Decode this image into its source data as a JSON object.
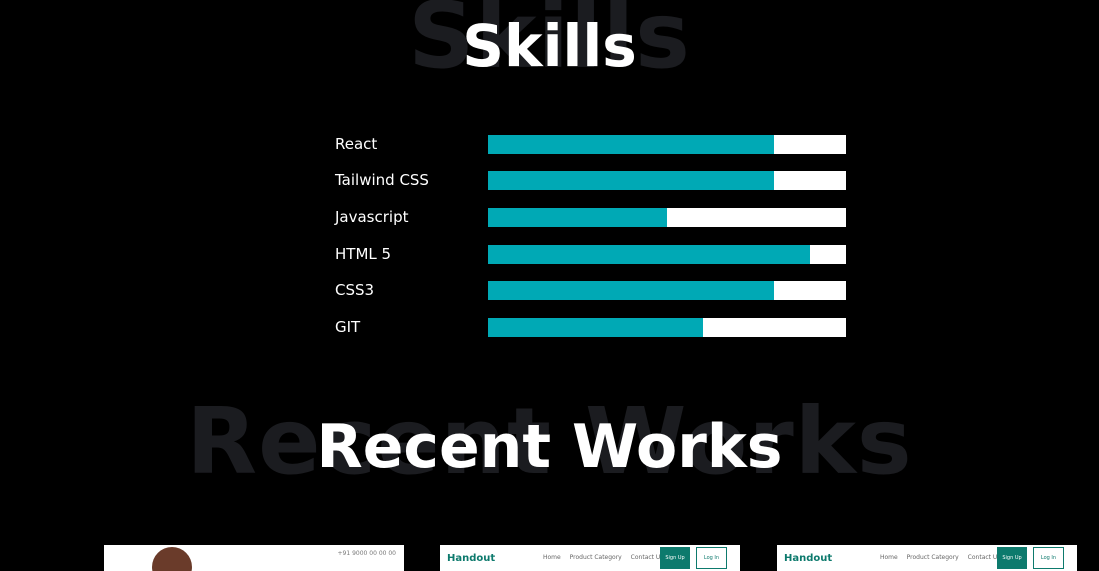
{
  "skills": {
    "bg_title": "Skills",
    "title": "Skills",
    "items": [
      {
        "label": "React",
        "level": 0.8
      },
      {
        "label": "Tailwind CSS",
        "level": 0.8
      },
      {
        "label": "Javascript",
        "level": 0.5
      },
      {
        "label": "HTML 5",
        "level": 0.9
      },
      {
        "label": "CSS3",
        "level": 0.8
      },
      {
        "label": "GIT",
        "level": 0.6
      }
    ],
    "colors": {
      "fill": "#00a9b5",
      "track": "#ffffff"
    }
  },
  "recent_works": {
    "bg_title": "Recent Works",
    "title": "Recent Works",
    "cards": [
      {
        "phone": "+91 9000 00 00 00"
      },
      {
        "brand": "Handout",
        "nav": [
          "Home",
          "Product Category",
          "Contact Us"
        ],
        "signup": "Sign Up",
        "login": "Log In"
      },
      {
        "brand": "Handout",
        "nav": [
          "Home",
          "Product Category",
          "Contact Us"
        ],
        "signup": "Sign Up",
        "login": "Log In"
      }
    ]
  }
}
